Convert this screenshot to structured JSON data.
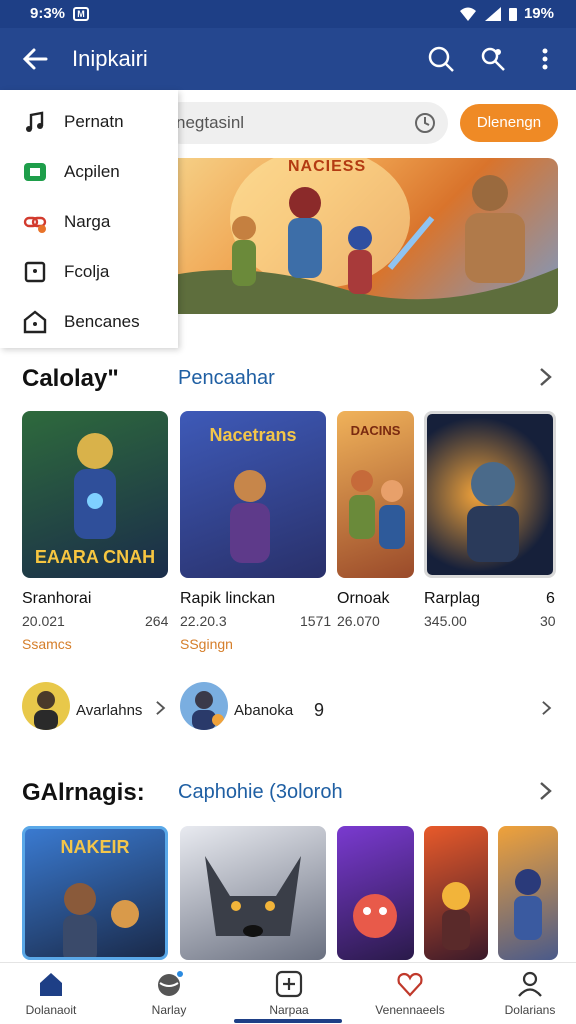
{
  "status_bar": {
    "time": "9:3%",
    "battery": "19%"
  },
  "app_bar": {
    "title": "Inipkairi"
  },
  "search": {
    "placeholder": "negtasinl",
    "button_label": "Dlenengn"
  },
  "hero": {
    "title": "NACIESS"
  },
  "drawer": {
    "items": [
      {
        "label": "Pernatn",
        "icon": "music-note-icon"
      },
      {
        "label": "Acpilen",
        "icon": "app-green-icon"
      },
      {
        "label": "Narga",
        "icon": "link-red-icon"
      },
      {
        "label": "Fcolja",
        "icon": "square-dot-icon"
      },
      {
        "label": "Bencanes",
        "icon": "home-box-icon"
      }
    ]
  },
  "section1": {
    "title": "Calolay\"",
    "link": "Pencaahar",
    "games": [
      {
        "art_title": "EAARA CNAH",
        "name": "Sranhorai",
        "num": "20.021",
        "num2": "264",
        "tag": "Ssamcs"
      },
      {
        "art_title": "Nacetrans",
        "name": "Rapik linckan",
        "num": "22.20.3",
        "num2": "1571",
        "tag": "SSgingn"
      },
      {
        "art_title": "DACINS",
        "name": "Ornoak",
        "num": "26.070",
        "num2": "",
        "tag": ""
      },
      {
        "art_title": "",
        "name": "Rarplag",
        "num": "345.00",
        "num2": "",
        "tag": ""
      },
      {
        "art_title": "",
        "name": "6",
        "num": "30",
        "num2": "",
        "tag": ""
      }
    ]
  },
  "avatars": [
    {
      "label": "Avarlahns"
    },
    {
      "label": "Abanoka",
      "extra": "9"
    }
  ],
  "section2": {
    "title": "GAlrnagis:",
    "link": "Caphohie (3oloroh",
    "cards": [
      {
        "art_title": "NAKEIR"
      },
      {
        "art_title": ""
      },
      {
        "art_title": ""
      },
      {
        "art_title": ""
      },
      {
        "art_title": ""
      }
    ]
  },
  "bottom_nav": [
    {
      "label": "Dolanaoit",
      "icon": "home-icon",
      "active": true
    },
    {
      "label": "Narlay",
      "icon": "globe-icon"
    },
    {
      "label": "Narpaa",
      "icon": "plus-box-icon"
    },
    {
      "label": "Venennaeels",
      "icon": "heart-icon"
    },
    {
      "label": "Dolarians",
      "icon": "profile-icon"
    }
  ],
  "colors": {
    "primary": "#25478f",
    "accent": "#ef8a25",
    "link": "#1f5fa3"
  }
}
